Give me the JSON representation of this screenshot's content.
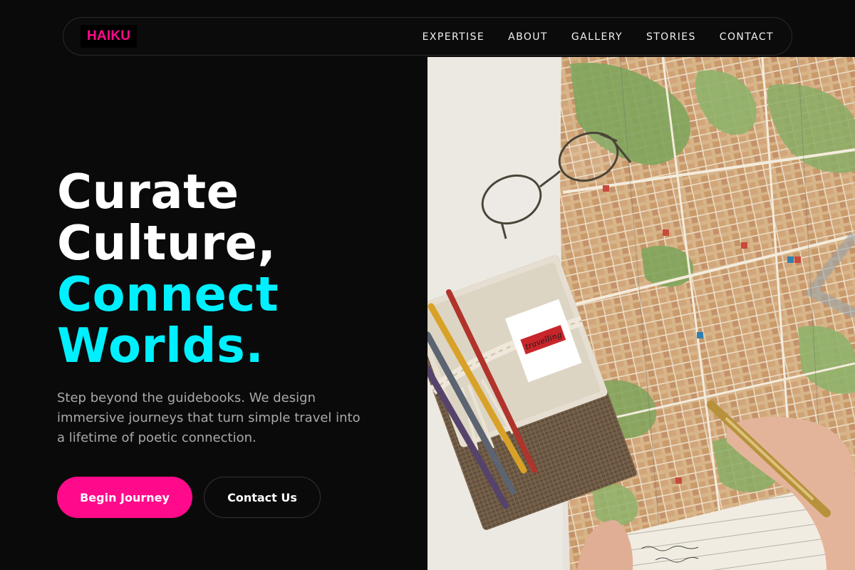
{
  "brand": {
    "logo_text": "HAIKU",
    "accent": "#ff0a8a"
  },
  "nav": {
    "items": [
      {
        "label": "EXPERTISE"
      },
      {
        "label": "ABOUT"
      },
      {
        "label": "GALLERY"
      },
      {
        "label": "STORIES"
      },
      {
        "label": "CONTACT"
      }
    ]
  },
  "hero": {
    "headline_lines": [
      "Curate",
      "Culture,",
      "Connect",
      "Worlds."
    ],
    "highlight_color": "#00f0ff",
    "subtitle": "Step beyond the guidebooks. We design immersive journeys that turn simple travel into a lifetime of poetic connection.",
    "primary_cta": "Begin Journey",
    "secondary_cta": "Contact Us",
    "image": {
      "subject": "travel-map-photo",
      "card_text": "travelling"
    }
  }
}
